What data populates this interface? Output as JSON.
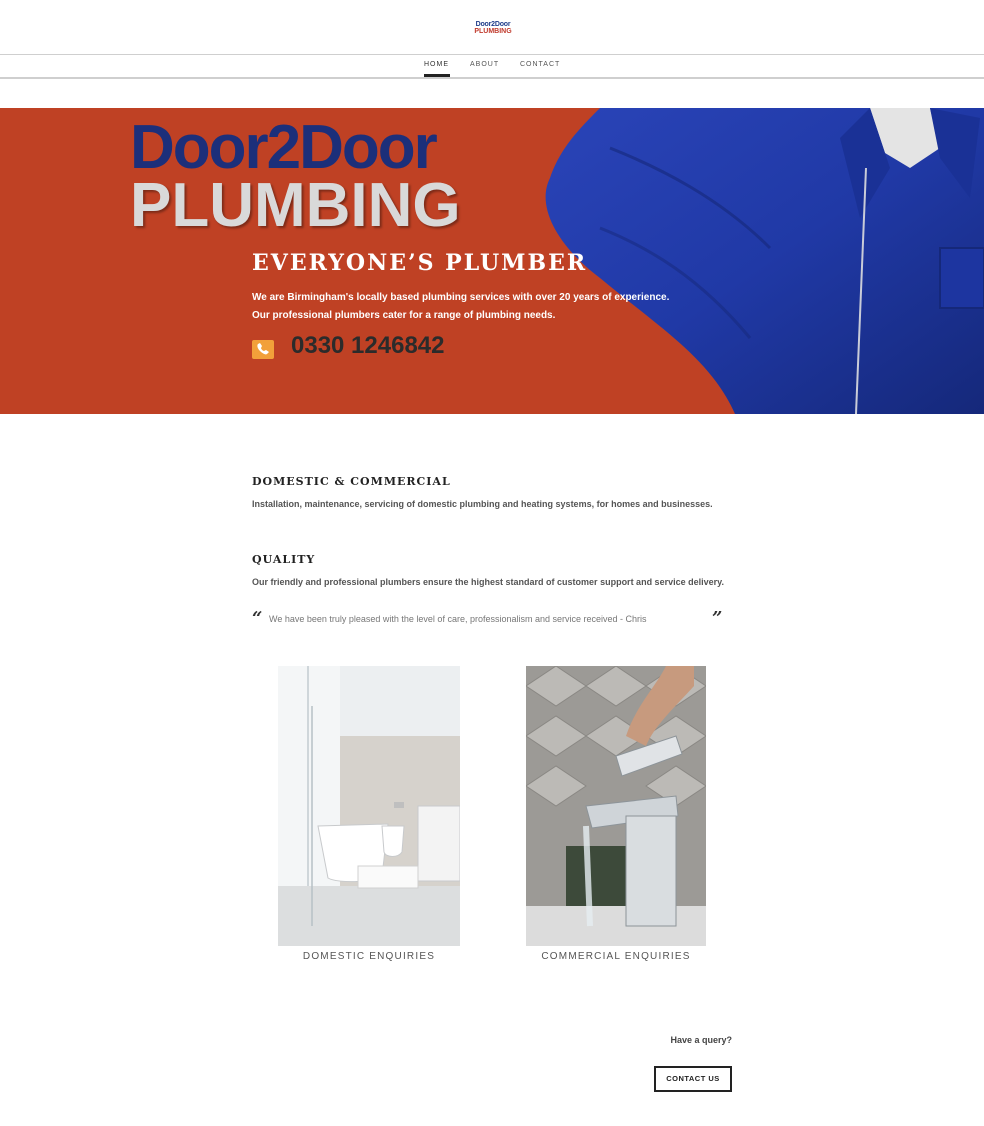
{
  "header": {
    "logo": {
      "line1": "Door2Door",
      "line2": "PLUMBING"
    },
    "nav": [
      "HOME",
      "ABOUT",
      "CONTACT"
    ],
    "active_nav": "HOME"
  },
  "hero": {
    "brand_line1": "Door2Door",
    "brand_line2": "PLUMBING",
    "tagline": "EVERYONE’S PLUMBER",
    "description_line1": "We are Birmingham's locally based plumbing services with over 20 years of experience.",
    "description_line2": "Our professional plumbers cater for a range of plumbing needs.",
    "phone": "0330 1246842",
    "colors": {
      "background": "#bf4124",
      "brand_blue": "#1c2f7a",
      "phone_icon": "#f2a03a"
    }
  },
  "sections": [
    {
      "title": "DOMESTIC & COMMERCIAL",
      "text": "Installation, maintenance, servicing of domestic plumbing and heating systems, for homes and businesses."
    },
    {
      "title": "QUALITY",
      "text": "Our friendly and professional plumbers ensure the highest standard of customer support and service delivery."
    }
  ],
  "testimonial": {
    "open": "“",
    "text": "We have been truly pleased with the level of care, professionalism and service received - Chris",
    "close": "”"
  },
  "cards": [
    {
      "label": "DOMESTIC ENQUIRIES",
      "image": "bathroom-photo"
    },
    {
      "label": "COMMERCIAL ENQUIRIES",
      "image": "tap-photo"
    }
  ],
  "cta": {
    "question": "Have a query?",
    "button": "CONTACT US"
  }
}
